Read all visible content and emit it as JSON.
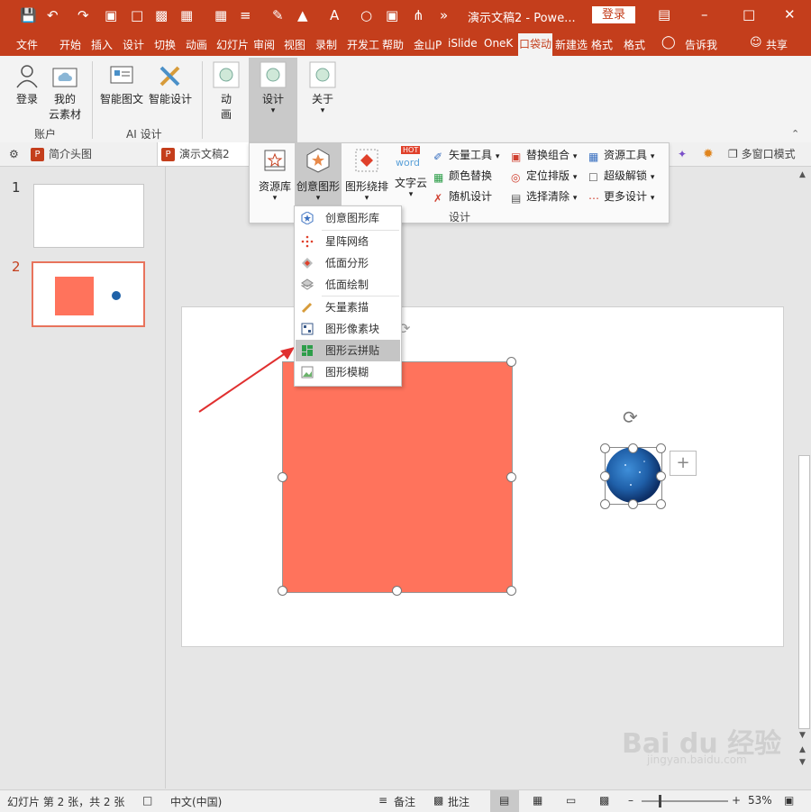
{
  "titlebar": {
    "doc_title": "演示文稿2 - Powe...",
    "login": "登录"
  },
  "tabs": [
    "文件",
    "开始",
    "插入",
    "设计",
    "切换",
    "动画",
    "幻灯片",
    "审阅",
    "视图",
    "录制",
    "开发工",
    "帮助",
    "金山P",
    "iSlide",
    "OneK"
  ],
  "active_tab": "口袋动",
  "tabs_right": [
    "新建选",
    "格式",
    "格式"
  ],
  "tell_me": "告诉我",
  "share": "共享",
  "ribbon": {
    "login": "登录",
    "my_cloud_line1": "我的",
    "my_cloud_line2": "云素材",
    "group_account": "账户",
    "smart_graphic": "智能图文",
    "smart_design": "智能设计",
    "group_ai": "AI 设计",
    "animation_line1": "动",
    "animation_line2": "画",
    "design": "设计",
    "about": "关于"
  },
  "doc_tabs": {
    "tab1": "简介头图",
    "tab2": "演示文稿2",
    "multi_window": "多窗口模式"
  },
  "design_panel": {
    "resource_lib": "资源库",
    "creative_shape": "创意图形",
    "shape_arrange": "图形绕排",
    "word_cloud": "文字云",
    "hot": "HOT",
    "word": "word",
    "vector_tools": "矢量工具",
    "color_replace": "颜色替换",
    "random_design": "随机设计",
    "replace_combo": "替换组合",
    "position_layout": "定位排版",
    "select_clear": "选择清除",
    "resource_tools": "资源工具",
    "super_unlock": "超级解锁",
    "more_design": "更多设计",
    "group_label": "设计"
  },
  "menu": {
    "items": [
      "创意图形库",
      "星阵网络",
      "低面分形",
      "低面绘制",
      "矢量素描",
      "图形像素块",
      "图形云拼贴",
      "图形模糊"
    ],
    "highlighted_index": 6
  },
  "slides": {
    "numbers": [
      "1",
      "2"
    ],
    "active": "2"
  },
  "status": {
    "slide_info": "幻灯片 第 2 张，共 2 张",
    "language": "中文(中国)",
    "notes": "备注",
    "comments": "批注",
    "zoom": "53%"
  },
  "watermark": {
    "brand": "Bai du 经验",
    "url": "jingyan.baidu.com"
  },
  "colors": {
    "brand_red": "#c43e1c",
    "shape_fill": "#ff735c",
    "menu_highlight": "#c5c5c5"
  }
}
